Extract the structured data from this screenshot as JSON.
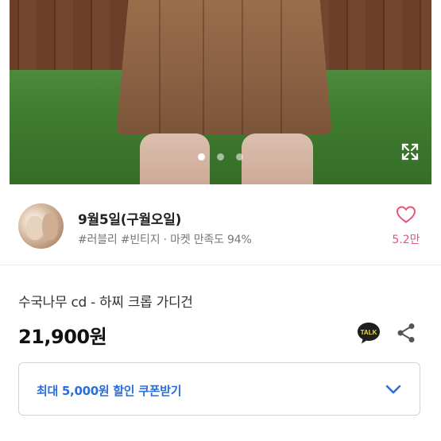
{
  "gallery": {
    "image_alt": "product photo",
    "slide_count": 3,
    "active_slide": 1,
    "icons": {
      "expand": "expand-icon"
    }
  },
  "seller": {
    "name": "9월5일(구월오일)",
    "meta": "#러블리 #빈티지 · 마켓 만족도 94%",
    "like_count": "5.2만",
    "icons": {
      "like": "heart-icon"
    },
    "accent_color": "#e4567a"
  },
  "product": {
    "title": "수국나무 cd - 하찌 크롭 가디건",
    "price": "21,900원",
    "icons": {
      "talk": "kakao-talk-icon",
      "share": "share-icon"
    },
    "talk_label": "TALK"
  },
  "coupon": {
    "label": "최대 5,000원 할인 쿠폰받기",
    "color": "#2a6fdb",
    "icons": {
      "toggle": "chevron-down-icon"
    }
  }
}
